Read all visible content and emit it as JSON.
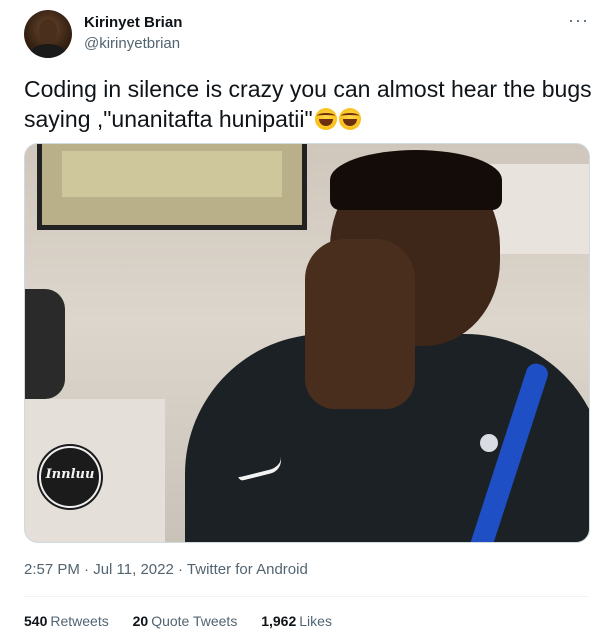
{
  "author": {
    "name": "Kirinyet Brian",
    "handle": "@kirinyetbrian"
  },
  "menu": {
    "more_label": "···"
  },
  "tweet": {
    "text": "Coding in silence is crazy you can almost hear the bugs saying ,\"unanitafta hunipatii\"",
    "emojis": [
      "face-with-tears-of-joy-icon",
      "face-with-tears-of-joy-icon"
    ]
  },
  "media": {
    "watermark": "Innluu"
  },
  "meta": {
    "time": "2:57 PM",
    "separator": "·",
    "date": "Jul 11, 2022",
    "source": "Twitter for Android"
  },
  "stats": {
    "retweets_count": "540",
    "retweets_label": "Retweets",
    "quotes_count": "20",
    "quotes_label": "Quote Tweets",
    "likes_count": "1,962",
    "likes_label": "Likes"
  },
  "colors": {
    "text_primary": "#0f1419",
    "text_secondary": "#536471",
    "border": "#cfd9de"
  }
}
